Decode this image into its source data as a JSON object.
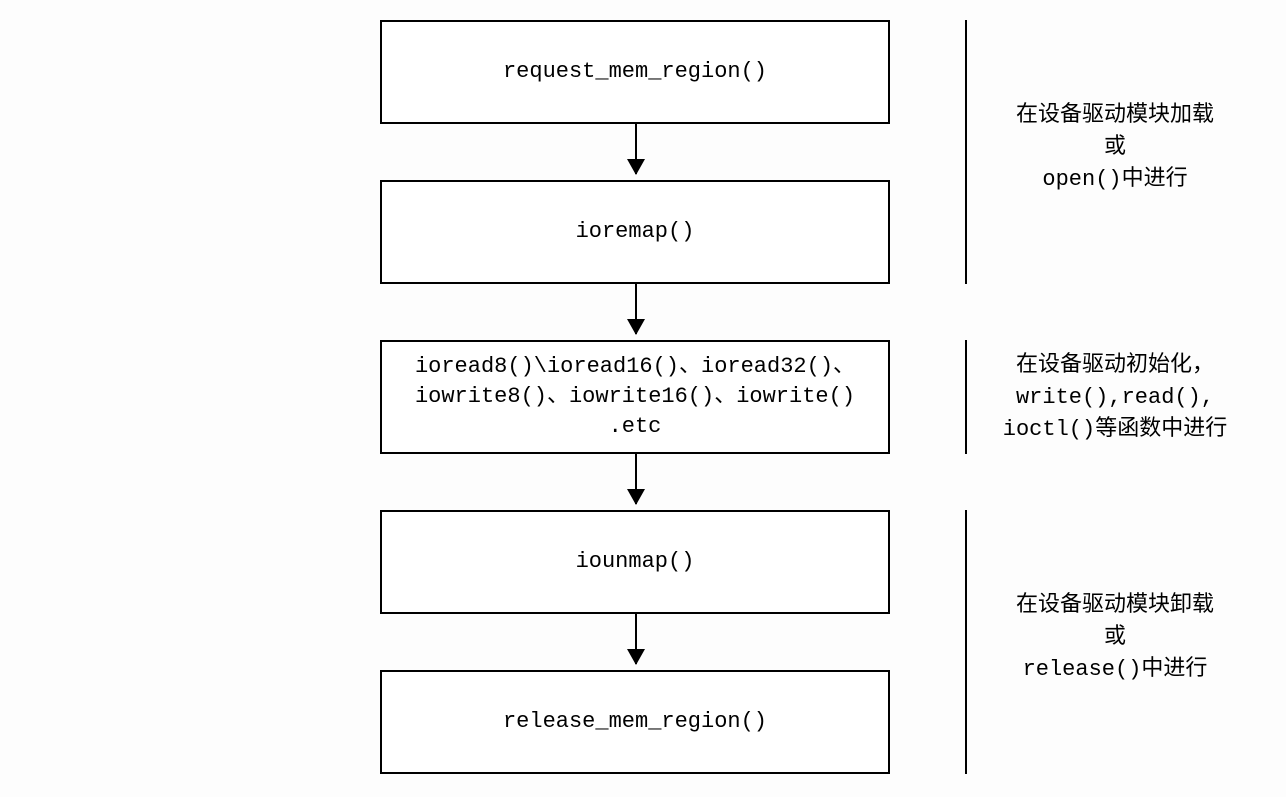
{
  "boxes": {
    "b1": "request_mem_region()",
    "b2": "ioremap()",
    "b3": "ioread8()\\ioread16()、ioread32()、\niowrite8()、iowrite16()、iowrite()\n.etc",
    "b4": "iounmap()",
    "b5": "release_mem_region()"
  },
  "annotations": {
    "a1": "在设备驱动模块加载\n或\nopen()中进行",
    "a2": "在设备驱动初始化，\nwrite(),read(),\nioctl()等函数中进行",
    "a3": "在设备驱动模块卸载\n或\nrelease()中进行"
  }
}
